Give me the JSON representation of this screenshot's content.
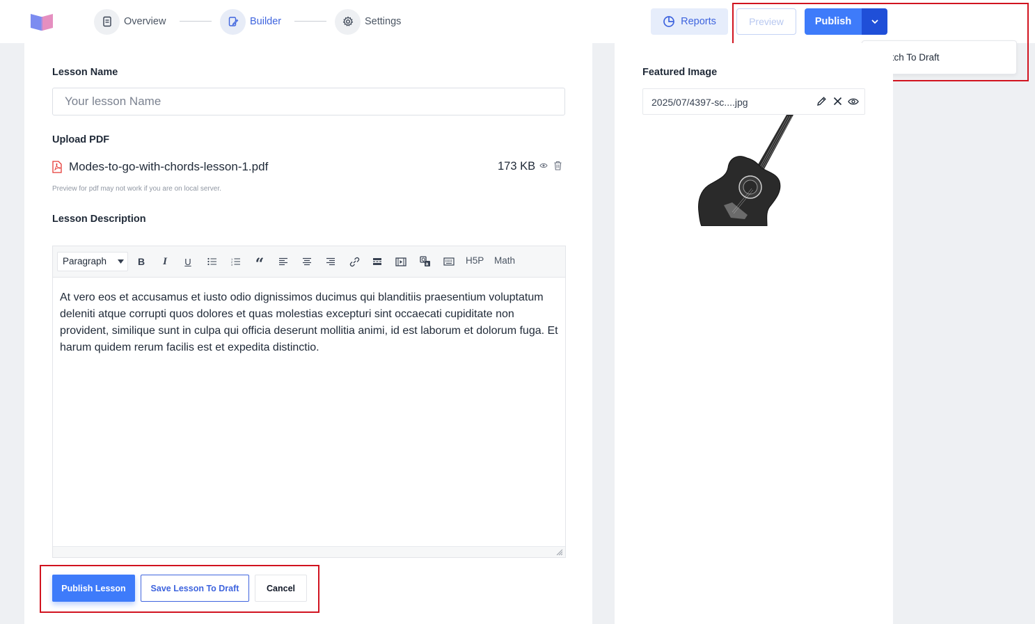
{
  "topbar": {
    "steps": [
      {
        "label": "Overview",
        "icon": "book-icon"
      },
      {
        "label": "Builder",
        "icon": "edit-icon"
      },
      {
        "label": "Settings",
        "icon": "gear-icon"
      }
    ],
    "reports_label": "Reports",
    "preview_label": "Preview",
    "publish_label": "Publish",
    "dropdown": {
      "item": "Switch To Draft"
    }
  },
  "form": {
    "lesson_name_label": "Lesson Name",
    "lesson_name_placeholder": "Your lesson Name",
    "upload_pdf_label": "Upload PDF",
    "pdf": {
      "file_name": "Modes-to-go-with-chords-lesson-1.pdf",
      "file_size": "173 KB",
      "note": "Preview for pdf may not work if you are on local server."
    },
    "description_label": "Lesson Description",
    "editor": {
      "block_format": "Paragraph",
      "h5p_label": "H5P",
      "math_label": "Math",
      "body": "At vero eos et accusamus et iusto odio dignissimos ducimus qui blanditiis praesentium voluptatum deleniti atque corrupti quos dolores et quas molestias excepturi sint occaecati cupiditate non provident, similique sunt in culpa qui officia deserunt mollitia animi, id est laborum et dolorum fuga. Et harum quidem rerum facilis est et expedita distinctio."
    },
    "actions": {
      "publish_lesson": "Publish Lesson",
      "save_draft": "Save Lesson To Draft",
      "cancel": "Cancel"
    }
  },
  "sidebar": {
    "featured_image_label": "Featured Image",
    "image_file": "2025/07/4397-sc....jpg"
  },
  "colors": {
    "primary": "#3e7bfa",
    "primary_dark": "#1f4fd8",
    "accent_text": "#3e64de",
    "highlight": "#d1131f",
    "background": "#eef0f3"
  }
}
